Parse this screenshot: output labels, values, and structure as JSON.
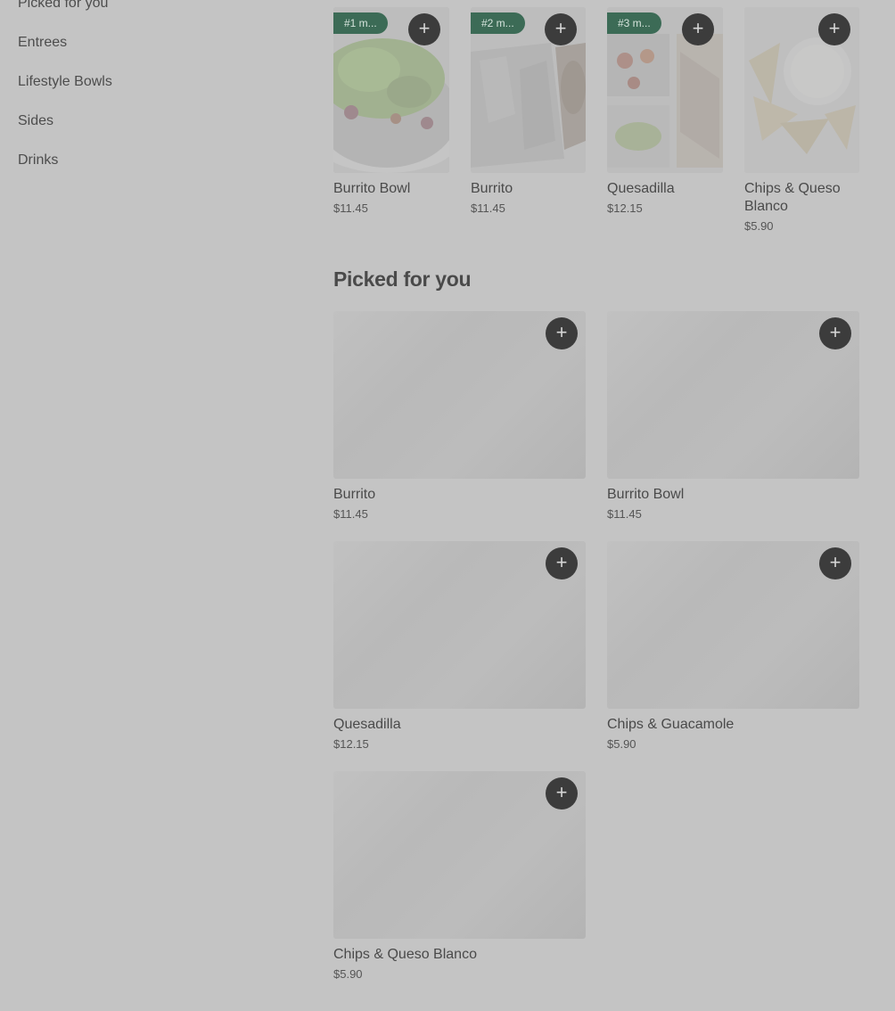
{
  "sidebar": {
    "items": [
      {
        "label": "Picked for you"
      },
      {
        "label": "Entrees"
      },
      {
        "label": "Lifestyle Bowls"
      },
      {
        "label": "Sides"
      },
      {
        "label": "Drinks"
      }
    ]
  },
  "featured": [
    {
      "badge": "#1 m...",
      "name": "Burrito Bowl",
      "price": "$11.45",
      "image": "burrito-bowl-photo"
    },
    {
      "badge": "#2 m...",
      "name": "Burrito",
      "price": "$11.45",
      "image": "burrito-photo"
    },
    {
      "badge": "#3 m...",
      "name": "Quesadilla",
      "price": "$12.15",
      "image": "quesadilla-photo"
    },
    {
      "badge": "",
      "name": "Chips & Queso Blanco",
      "price": "$5.90",
      "image": "chips-queso-photo"
    }
  ],
  "picked_section": {
    "title": "Picked for you",
    "items": [
      {
        "name": "Burrito",
        "price": "$11.45"
      },
      {
        "name": "Burrito Bowl",
        "price": "$11.45"
      },
      {
        "name": "Quesadilla",
        "price": "$12.15"
      },
      {
        "name": "Chips & Guacamole",
        "price": "$5.90"
      },
      {
        "name": "Chips & Queso Blanco",
        "price": "$5.90"
      }
    ]
  },
  "icons": {
    "add": "plus-icon"
  },
  "colors": {
    "badge": "#3c6b56",
    "add_button": "#3c3c3c",
    "background": "#c4c4c4"
  }
}
